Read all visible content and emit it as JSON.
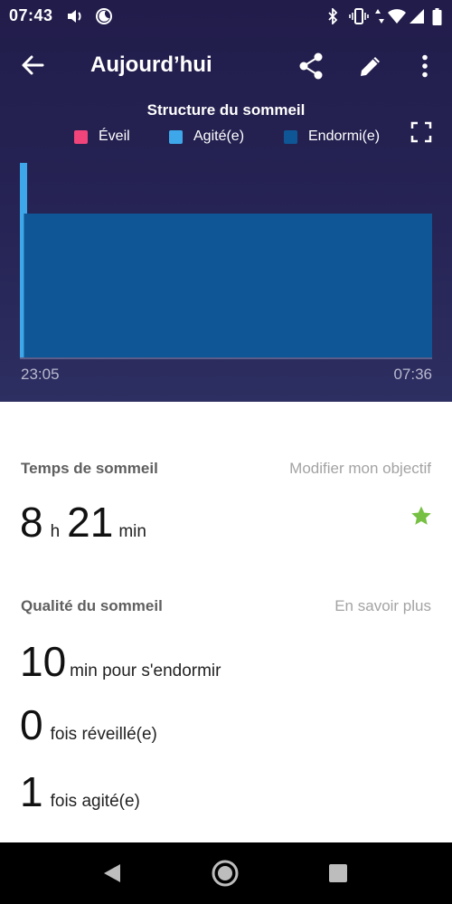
{
  "status_bar": {
    "time": "07:43",
    "icons": [
      "volume-icon",
      "do-not-disturb-moon-icon",
      "bluetooth-icon",
      "vibrate-icon",
      "data-arrows-icon",
      "wifi-icon",
      "signal-icon",
      "battery-icon"
    ]
  },
  "app_bar": {
    "title": "Aujourd’hui",
    "actions": [
      "share-icon",
      "edit-pencil-icon",
      "more-vert-icon"
    ]
  },
  "chart_data": {
    "type": "area",
    "title": "Structure du sommeil",
    "legend": [
      {
        "label": "Éveil",
        "color": "#f0447a"
      },
      {
        "label": "Agité(e)",
        "color": "#3ea7ea"
      },
      {
        "label": "Endormi(e)",
        "color": "#0f5696"
      }
    ],
    "x_start_label": "23:05",
    "x_end_label": "07:36",
    "segments": [
      {
        "stage": "Agité(e)",
        "start": "23:05",
        "end": "23:10"
      },
      {
        "stage": "Endormi(e)",
        "start": "23:10",
        "end": "07:36"
      }
    ],
    "legend_placement": "top"
  },
  "sleep_time": {
    "heading": "Temps de sommeil",
    "link": "Modifier mon objectif",
    "hours": "8",
    "hours_unit": "h",
    "minutes": "21",
    "minutes_unit": "min",
    "goal_icon": "star-icon",
    "goal_color": "#76c043"
  },
  "sleep_quality": {
    "heading": "Qualité du sommeil",
    "link": "En savoir plus",
    "items": [
      {
        "value": "10",
        "label": "min pour s'endormir"
      },
      {
        "value": "0",
        "label": "fois réveillé(e)"
      },
      {
        "value": "1",
        "label": "fois agité(e)"
      }
    ]
  },
  "nav_bar": {
    "buttons": [
      "back-triangle-icon",
      "home-circle-icon",
      "recents-square-icon"
    ]
  }
}
